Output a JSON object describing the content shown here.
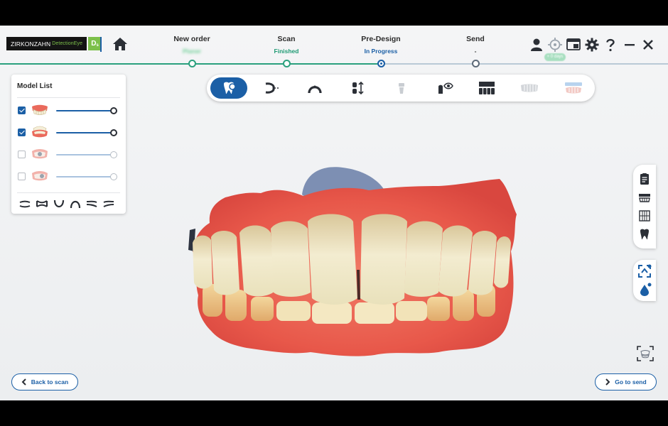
{
  "brand": {
    "company": "ZIRKONZAHN",
    "product": "DetectionEye",
    "mark": "D"
  },
  "workflow": {
    "steps": [
      {
        "name": "New order",
        "status": "Planer"
      },
      {
        "name": "Scan",
        "status": "Finished"
      },
      {
        "name": "Pre-Design",
        "status": "In Progress"
      },
      {
        "name": "Send",
        "status": "-"
      }
    ]
  },
  "header": {
    "badge": "+ 0 days"
  },
  "toolbar": {
    "tools": [
      "tooth-select-icon",
      "occlusion-icon",
      "arch-icon",
      "distance-icon",
      "implant-icon",
      "view-icon",
      "crowns-icon",
      "bridge-icon",
      "face-scan-icon"
    ],
    "active_index": 0
  },
  "model_list": {
    "title": "Model List",
    "models": [
      {
        "name": "upper-jaw",
        "checked": true,
        "opacity": 1.0
      },
      {
        "name": "lower-jaw",
        "checked": true,
        "opacity": 1.0
      },
      {
        "name": "upper-jaw-scan",
        "checked": false,
        "opacity": 1.0
      },
      {
        "name": "lower-jaw-scan",
        "checked": false,
        "opacity": 1.0
      }
    ],
    "arch_views": [
      "upper-open-icon",
      "bite-icon",
      "lower-icon",
      "upper-icon",
      "right-bite-icon",
      "left-bite-icon"
    ]
  },
  "footer": {
    "back_label": "Back to scan",
    "next_label": "Go to send"
  },
  "colors": {
    "accent": "#1b5fa6",
    "done": "#2aa07e",
    "gum": "#e8584a",
    "tooth": "#efe6c2"
  }
}
